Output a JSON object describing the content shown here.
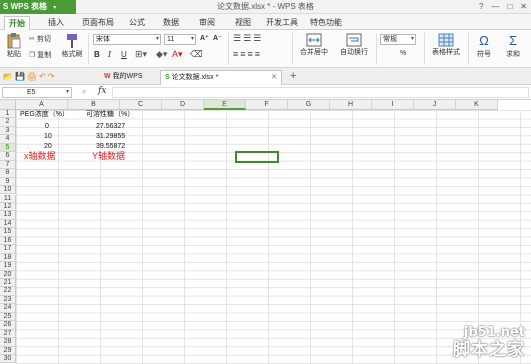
{
  "titlebar": {
    "app_name": "WPS 表格",
    "doc_title": "论文数据.xlsx * - WPS 表格",
    "controls": [
      "?",
      "—",
      "□",
      "✕"
    ]
  },
  "menu": {
    "tabs": [
      "开始",
      "插入",
      "页面布局",
      "公式",
      "数据",
      "审阅",
      "视图",
      "开发工具",
      "特色功能"
    ],
    "active": "开始"
  },
  "ribbon": {
    "paste": "粘贴",
    "cut": "剪切",
    "copy": "复制",
    "format_painter": "格式刷",
    "font_name": "宋体",
    "font_size": "11",
    "font_grow": "A⁺",
    "font_shrink": "A⁻",
    "bold": "B",
    "italic": "I",
    "underline": "U",
    "merge_center": "合并居中",
    "wrap_text": "自动换行",
    "number_format": "常规",
    "percent": "%",
    "table_style": "表格样式",
    "symbol": "符号",
    "sum": "求和"
  },
  "doc_tabs": {
    "items": [
      "我的WPS",
      "论文数据.xlsx *"
    ],
    "add": "+"
  },
  "formula_bar": {
    "cell_ref": "E5",
    "fx": "fx",
    "value": ""
  },
  "sheet": {
    "columns": [
      "A",
      "B",
      "C",
      "D",
      "E",
      "F",
      "G",
      "H",
      "I",
      "J",
      "K"
    ],
    "selected_col": "E",
    "rows": [
      "1",
      "2",
      "3",
      "4",
      "5",
      "6",
      "7",
      "8",
      "9",
      "10",
      "11",
      "12",
      "13",
      "14",
      "15",
      "16",
      "17",
      "18",
      "19",
      "20",
      "21",
      "22",
      "23",
      "24",
      "25",
      "26",
      "27",
      "28",
      "29",
      "30"
    ],
    "selected_row": "5",
    "cells": {
      "A1": "PEG浓度（%）",
      "B1": "可溶性糖（%）",
      "A2": "0",
      "B2": "27.56327",
      "A3": "10",
      "B3": "31.29855",
      "A4": "20",
      "B4": "39.55872",
      "A5": "x轴数据",
      "B5": "Y轴数据"
    },
    "active_cell": "E5",
    "annotation_color": "#e02020",
    "accent_color": "#3f8a2e"
  },
  "watermark": {
    "site": "jb51.net",
    "brand": "脚本之家"
  }
}
